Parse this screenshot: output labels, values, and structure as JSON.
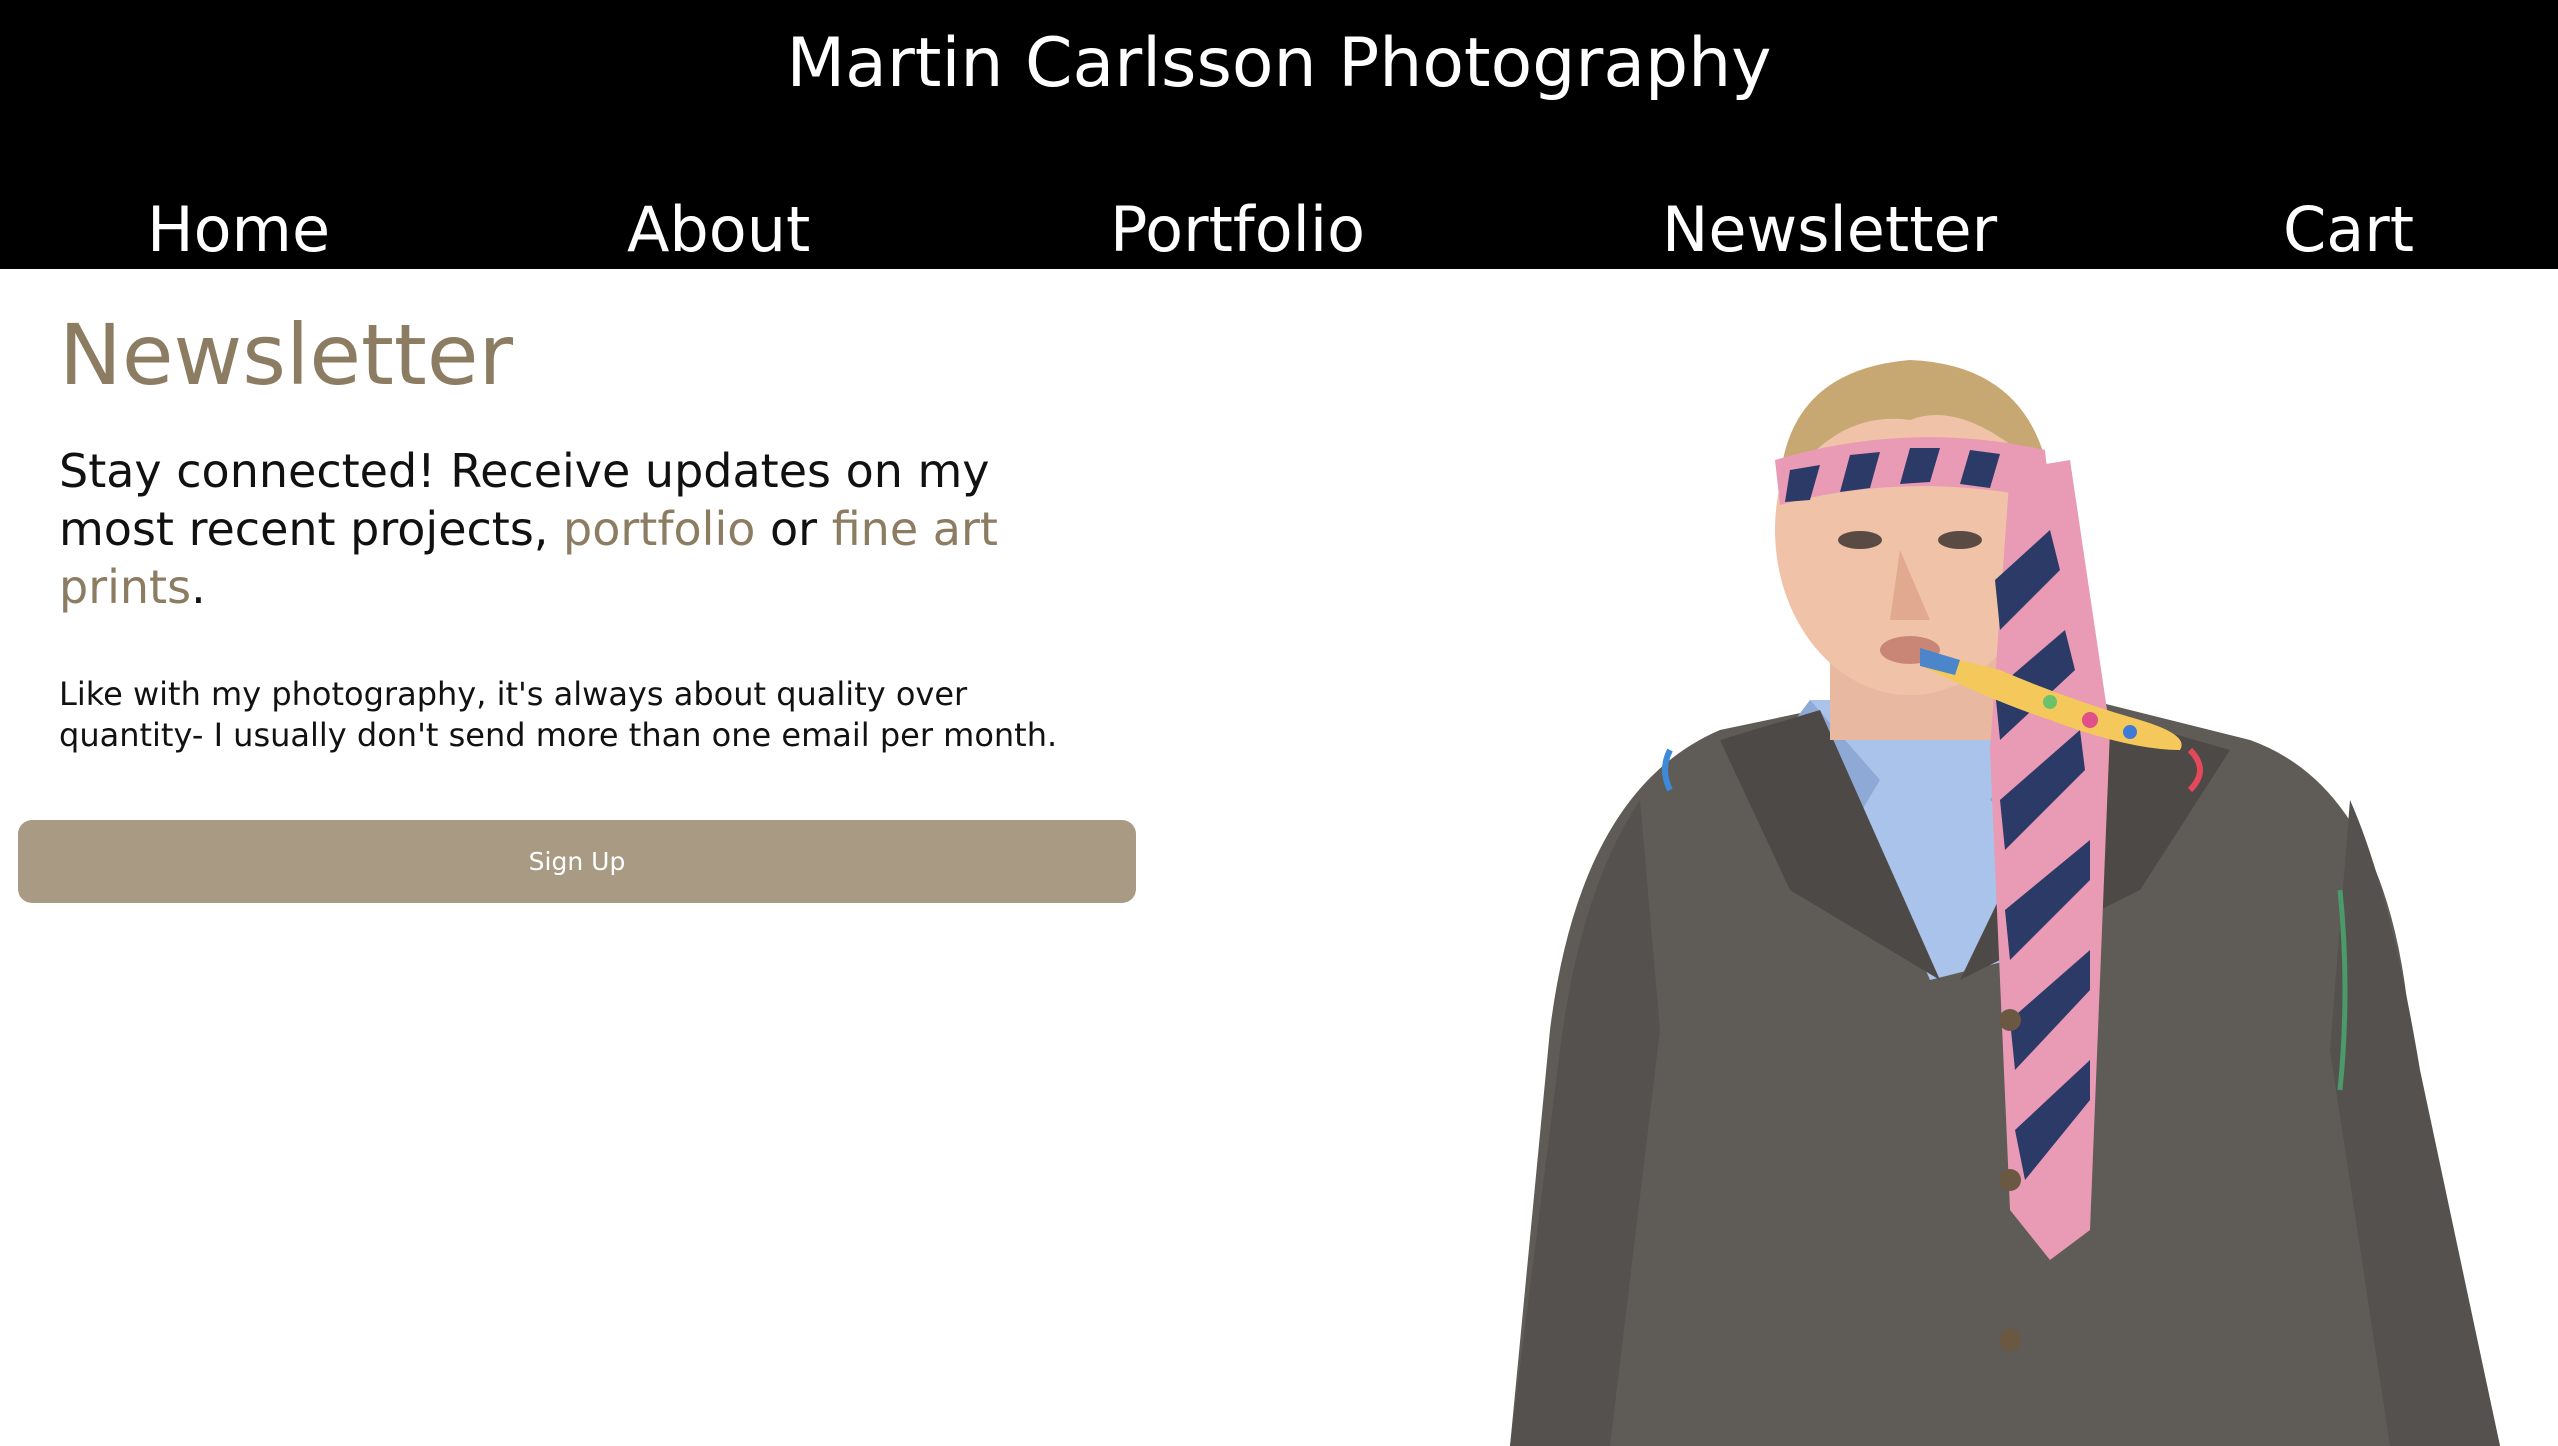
{
  "header": {
    "title": "Martin Carlsson Photography"
  },
  "nav": {
    "items": [
      {
        "label": "Home"
      },
      {
        "label": "About"
      },
      {
        "label": "Portfolio"
      },
      {
        "label": "Newsletter"
      },
      {
        "label": "Cart"
      }
    ]
  },
  "main": {
    "heading": "Newsletter",
    "intro": {
      "text_before": "Stay connected! Receive updates on my most recent projects, ",
      "link_portfolio": "portfolio",
      "text_or": " or ",
      "link_prints": "fine art prints",
      "text_end": "."
    },
    "note": "Like with my photography, it's always about quality over quantity- I usually don't send more than one email per month.",
    "signup_label": "Sign Up"
  },
  "hero_image": {
    "icon": "portrait-photo"
  },
  "colors": {
    "header_bg": "#000000",
    "accent": "#8b7c62",
    "button_bg": "#a89a83",
    "text": "#111111"
  }
}
